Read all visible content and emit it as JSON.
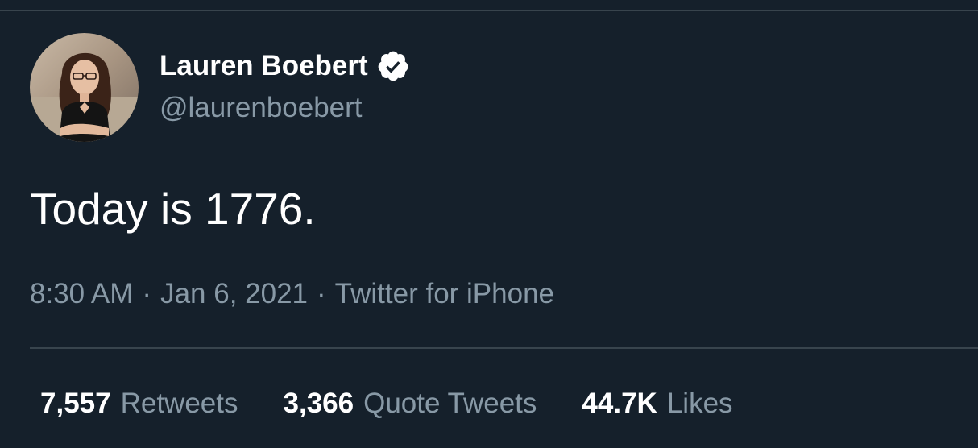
{
  "tweet": {
    "author": {
      "display_name": "Lauren Boebert",
      "handle": "@laurenboebert",
      "verified": true,
      "verified_icon": "verified-badge-icon"
    },
    "text": "Today is 1776.",
    "time": "8:30 AM",
    "date": "Jan 6, 2021",
    "source": "Twitter for iPhone",
    "separator": "·",
    "stats": [
      {
        "value": "7,557",
        "label": "Retweets"
      },
      {
        "value": "3,366",
        "label": "Quote Tweets"
      },
      {
        "value": "44.7K",
        "label": "Likes"
      }
    ]
  },
  "colors": {
    "background": "#15202b",
    "text_primary": "#ffffff",
    "text_secondary": "#8899a6",
    "divider": "#38444d"
  }
}
